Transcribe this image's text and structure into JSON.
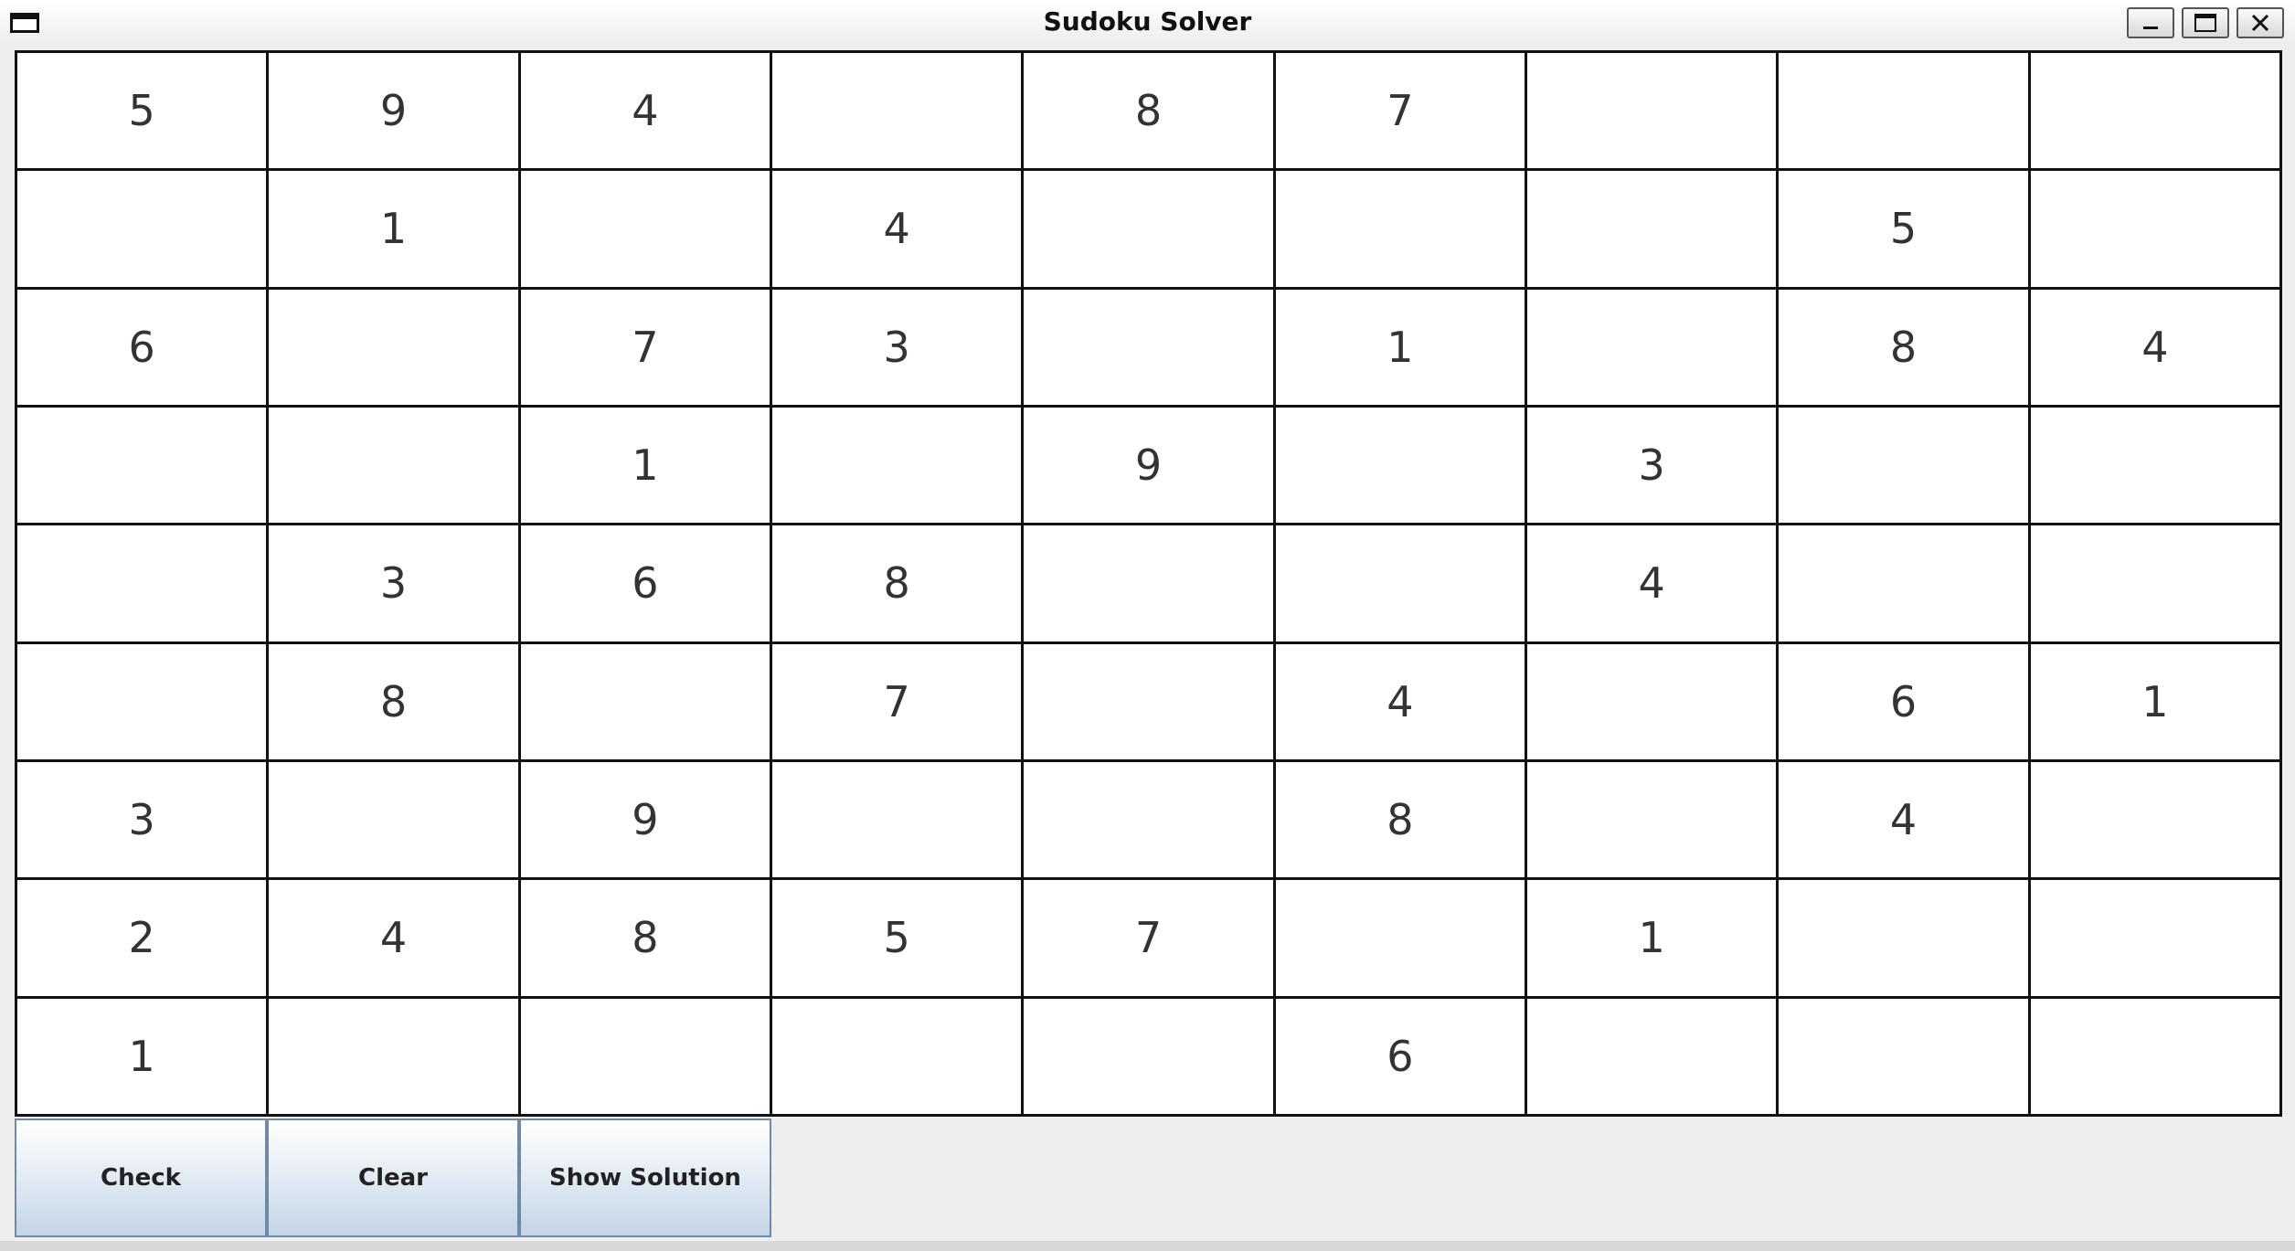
{
  "window": {
    "title": "Sudoku Solver",
    "icons": {
      "app": "window-icon",
      "minimize": "minimize-icon",
      "maximize": "maximize-icon",
      "close": "close-icon"
    }
  },
  "grid": {
    "rows": [
      [
        "5",
        "9",
        "4",
        "",
        "8",
        "7",
        "",
        "",
        ""
      ],
      [
        "",
        "1",
        "",
        "4",
        "",
        "",
        "",
        "5",
        ""
      ],
      [
        "6",
        "",
        "7",
        "3",
        "",
        "1",
        "",
        "8",
        "4"
      ],
      [
        "",
        "",
        "1",
        "",
        "9",
        "",
        "3",
        "",
        ""
      ],
      [
        "",
        "3",
        "6",
        "8",
        "",
        "",
        "4",
        "",
        ""
      ],
      [
        "",
        "8",
        "",
        "7",
        "",
        "4",
        "",
        "6",
        "1"
      ],
      [
        "3",
        "",
        "9",
        "",
        "",
        "8",
        "",
        "4",
        ""
      ],
      [
        "2",
        "4",
        "8",
        "5",
        "7",
        "",
        "1",
        "",
        ""
      ],
      [
        "1",
        "",
        "",
        "",
        "",
        "6",
        "",
        "",
        ""
      ]
    ]
  },
  "buttons": {
    "check": "Check",
    "clear": "Clear",
    "show_solution": "Show Solution"
  },
  "colors": {
    "grid_line": "#111111",
    "cell_bg": "#ffffff",
    "digit": "#333333",
    "button_top": "#ffffff",
    "button_bottom": "#c3d4e6",
    "button_border": "#6f8aa6",
    "window_bg": "#eeeeee"
  }
}
